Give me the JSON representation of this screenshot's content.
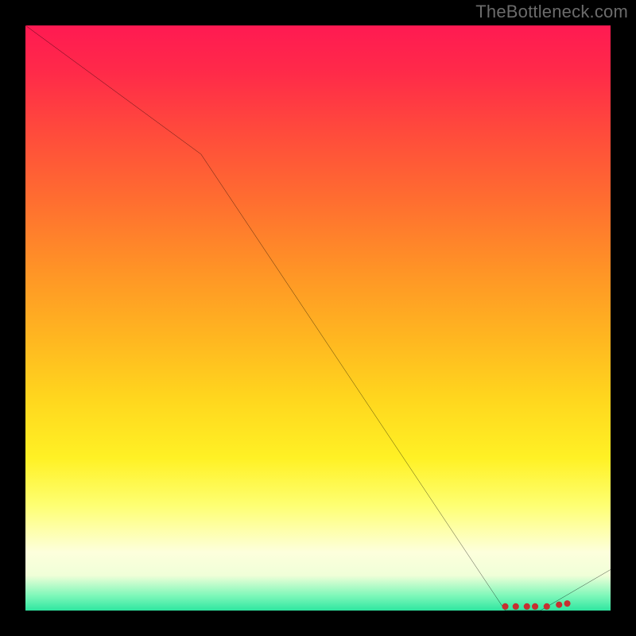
{
  "attribution": "TheBottleneck.com",
  "chart_data": {
    "type": "line",
    "title": "",
    "xlabel": "",
    "ylabel": "",
    "xlim": [
      0,
      100
    ],
    "ylim": [
      0,
      100
    ],
    "series": [
      {
        "name": "curve",
        "x": [
          0,
          30,
          82,
          88,
          100
        ],
        "values": [
          100,
          78,
          0,
          0,
          7
        ]
      }
    ],
    "markers": {
      "name": "red-dots",
      "x": [
        82,
        83.8,
        85.7,
        87.1,
        89.1,
        91.2,
        92.6
      ],
      "values": [
        0.7,
        0.7,
        0.7,
        0.7,
        0.7,
        1.0,
        1.2
      ]
    }
  },
  "colors": {
    "curve": "#000000",
    "marker": "#c53030",
    "frame": "#000000"
  }
}
